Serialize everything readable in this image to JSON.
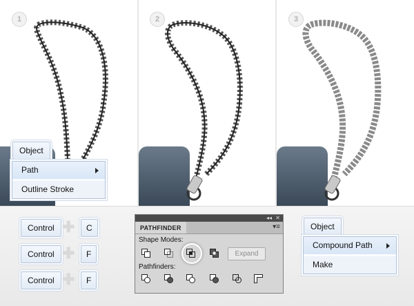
{
  "steps": [
    "1",
    "2",
    "3"
  ],
  "menu_left": {
    "object_label": "Object",
    "items": [
      {
        "label": "Path",
        "has_submenu": true
      },
      {
        "label": "Outline Stroke",
        "has_submenu": false
      }
    ]
  },
  "menu_right": {
    "object_label": "Object",
    "items": [
      {
        "label": "Compound Path",
        "has_submenu": true
      },
      {
        "label": "Make",
        "has_submenu": false
      }
    ]
  },
  "shortcuts": [
    {
      "mod": "Control",
      "key": "C"
    },
    {
      "mod": "Control",
      "key": "F"
    },
    {
      "mod": "Control",
      "key": "F"
    }
  ],
  "pathfinder": {
    "tab": "PATHFINDER",
    "shape_modes_label": "Shape Modes:",
    "pathfinders_label": "Pathfinders:",
    "expand_label": "Expand",
    "shape_mode_icons": [
      "unite-icon",
      "minus-front-icon",
      "intersect-icon",
      "exclude-icon"
    ],
    "pathfinder_icons": [
      "divide-icon",
      "trim-icon",
      "merge-icon",
      "crop-icon",
      "outline-icon",
      "minus-back-icon"
    ]
  },
  "colors": {
    "accent": "#d8e6f6",
    "border": "#b3c3d8"
  }
}
